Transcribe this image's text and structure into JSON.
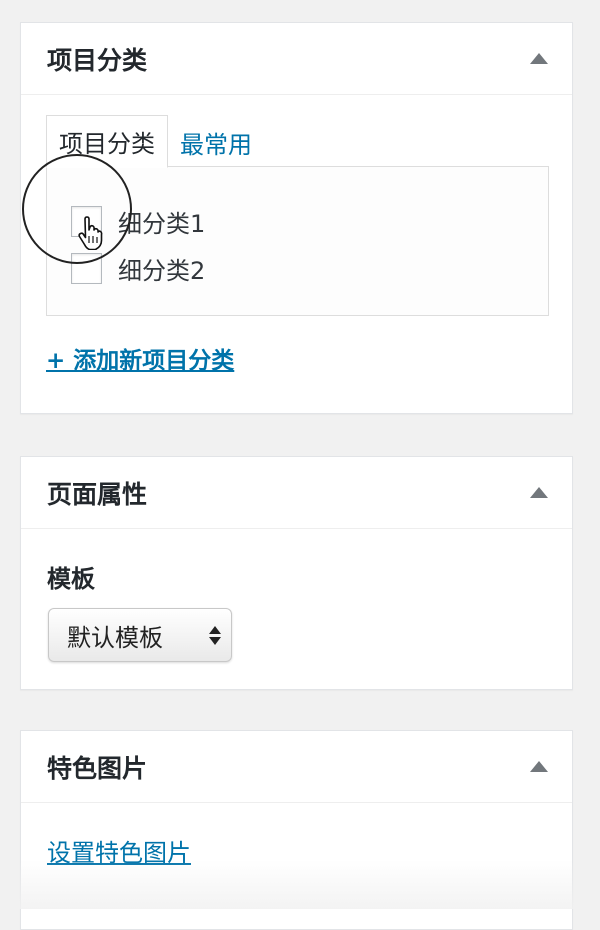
{
  "categories_box": {
    "title": "项目分类",
    "tabs": [
      {
        "label": "项目分类",
        "active": true
      },
      {
        "label": "最常用",
        "active": false
      }
    ],
    "items": [
      {
        "label": "细分类1",
        "checked": false
      },
      {
        "label": "细分类2",
        "checked": false
      }
    ],
    "add_link": "+ 添加新项目分类"
  },
  "attributes_box": {
    "title": "页面属性",
    "template_label": "模板",
    "template_value": "默认模板"
  },
  "featured_box": {
    "title": "特色图片",
    "set_link": "设置特色图片"
  },
  "colors": {
    "link": "#0073aa",
    "background": "#f1f1f1"
  }
}
